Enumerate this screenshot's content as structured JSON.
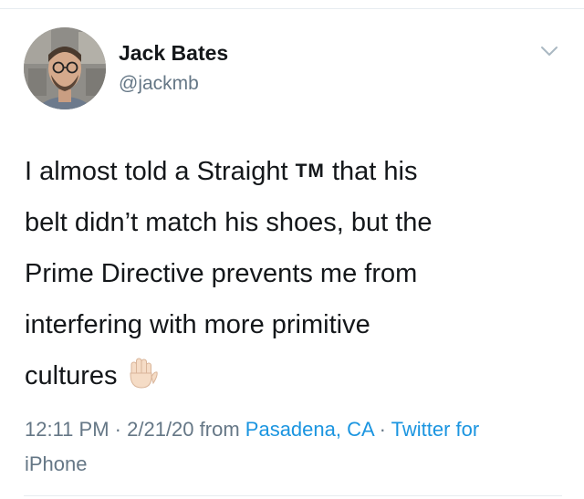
{
  "user": {
    "name": "Jack Bates",
    "handle": "@jackmb"
  },
  "tweet": {
    "lines": [
      "I almost told a Straight",
      "TM",
      "that his",
      "belt didn’t match his shoes, but the",
      "Prime Directive prevents me from",
      "interfering with more primitive",
      "cultures"
    ],
    "emoji": "raised-hand-icon"
  },
  "meta": {
    "time": "12:11 PM",
    "separator": "·",
    "date": "2/21/20",
    "from_label": "from",
    "location": "Pasadena, CA",
    "client_line1": "Twitter for",
    "client_line2": "iPhone"
  },
  "colors": {
    "text": "#14171a",
    "secondary": "#657786",
    "link": "#1b95e0",
    "divider": "#e6ecf0"
  },
  "icons": {
    "menu": "chevron-down-icon",
    "avatar": "avatar"
  }
}
